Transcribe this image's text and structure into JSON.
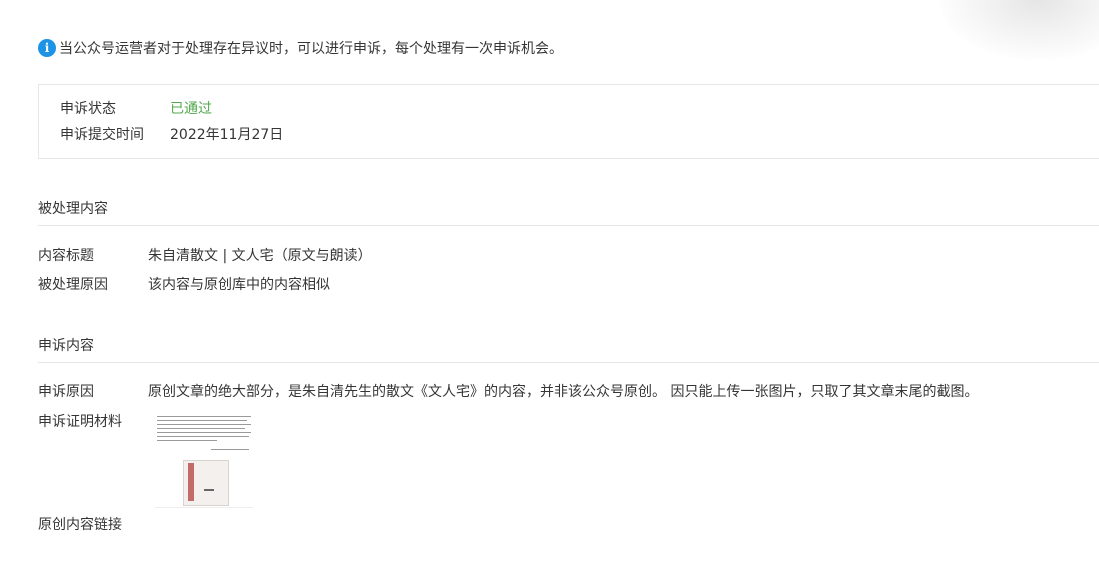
{
  "notice": {
    "icon": "info-icon",
    "icon_color": "#1d93e6",
    "text": "当公众号运营者对于处理存在异议时，可以进行申诉，每个处理有一次申诉机会。"
  },
  "status": {
    "state_label": "申诉状态",
    "state_value": "已通过",
    "state_color": "#52a84d",
    "submit_label": "申诉提交时间",
    "submit_value": "2022年11月27日"
  },
  "processed": {
    "title": "被处理内容",
    "content_title_label": "内容标题",
    "content_title_value": "朱自清散文 | 文人宅（原文与朗读）",
    "reason_label": "被处理原因",
    "reason_value": "该内容与原创库中的内容相似"
  },
  "appeal": {
    "title": "申诉内容",
    "reason_label": "申诉原因",
    "reason_value": "原创文章的绝大部分，是朱自清先生的散文《文人宅》的内容，并非该公众号原创。 因只能上传一张图片，只取了其文章末尾的截图。",
    "evidence_label": "申诉证明材料",
    "original_link_label": "原创内容链接"
  }
}
